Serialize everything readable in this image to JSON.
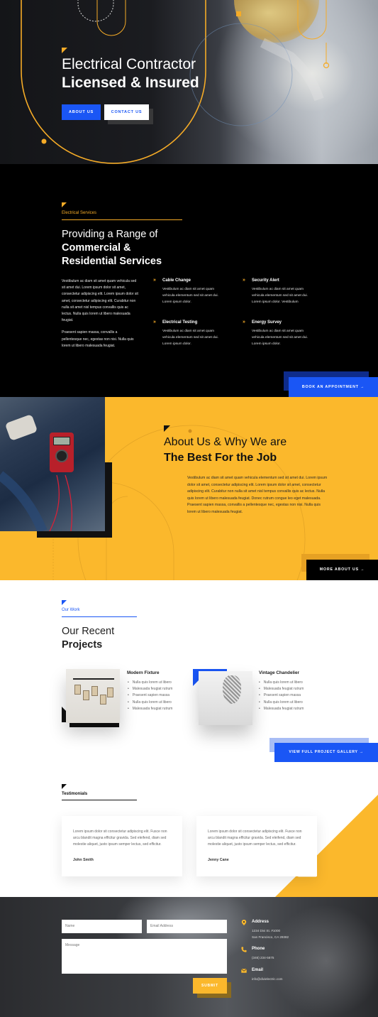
{
  "hero": {
    "title_line1": "Electrical Contractor",
    "title_line2": "Licensed & Insured",
    "about_button": "ABOUT US",
    "contact_button": "CONTACT US",
    "accent_color": "#f5ab27",
    "primary_color": "#1a56f5"
  },
  "services": {
    "kicker": "Electrical Services",
    "heading_line1": "Providing a Range of",
    "heading_line2": "Commercial &",
    "heading_line3": "Residential Services",
    "paragraph1": "Vestibulum ac diam sit amet quam vehicula sed sit amet dui. Lorem ipsum dolor sit amet, consectetur adipiscing elit. Lorem ipsum dolor sit amet, consectetur adipiscing elit. Curabitur non nulla sit amet nisl tempus convallis quis ac lectus. Nulla quis lorem ut libero malesuada feugiat.",
    "paragraph2": "Praesent sapien massa, convallis a pellentesque nec, egestas non nisi. Nulla quis lorem ut libero malesuada feugiat.",
    "items": [
      {
        "title": "Cable Change",
        "desc": "Vestibulum ac diam sit amet quam vehicula elementum sed sit amet dui. Lorem ipsum dolor."
      },
      {
        "title": "Security Alert",
        "desc": "Vestibulum ac diam sit amet quam vehicula elementum sed sit amet dui. Lorem ipsum dolor. Vestibulum"
      },
      {
        "title": "Electrical Testing",
        "desc": "Vestibulum ac diam sit amet quam vehicula elementum sed sit amet dui. Lorem ipsum dolor."
      },
      {
        "title": "Energy Survey",
        "desc": "Vestibulum ac diam sit amet quam vehicula elementum sed sit amet dui. Lorem ipsum dolor."
      }
    ],
    "book_button": "BOOK AN APPOINTMENT →"
  },
  "about": {
    "heading_line1": "About Us & Why We are",
    "heading_line2": "The Best For the Job",
    "paragraph": "Vestibulum ac diam sit amet quam vehicula elementum sed sit amet dui. Lorem ipsum dolor sit amet, consectetur adipiscing elit. Lorem ipsum dolor sit amet, consectetur adipiscing elit. Curabitur non nulla sit amet nisl tempus convallis quis ac lectus. Nulla quis lorem ut libero malesuada feugiat. Donec rutrum congue leo eget malesuada. Praesent sapien massa, convallis a pellentesque nec, egestas non nisi. Nulla quis lorem ut libero malesuada feugiat.",
    "more_button": "MORE ABOUT US →",
    "bg_color": "#fbb82c"
  },
  "projects": {
    "kicker": "Our Work",
    "heading_line1": "Our Recent",
    "heading_line2": "Projects",
    "items": [
      {
        "title": "Modern Fixture",
        "bullets": [
          "Nulla quis lorem ut libero",
          "Malesuada feugiat rutrum",
          "Praesent sapien massa",
          "Nulla quis lorem ut libero",
          "Malesuada feugiat rutrum"
        ]
      },
      {
        "title": "Vintage Chandelier",
        "bullets": [
          "Nulla quis lorem ut libero",
          "Malesuada feugiat rutrum",
          "Praesent sapien massa",
          "Nulla quis lorem ut libero",
          "Malesuada feugiat rutrum"
        ]
      }
    ],
    "gallery_button": "VIEW FULL PROJECT GALLERY →"
  },
  "testimonials": {
    "kicker": "Testimonials",
    "items": [
      {
        "quote": "Lorem ipsum dolor sit consectetur adipiscing elit. Fusce non arcu blandit magna efficitur gravida. Sed eleifend, diam sed molestie aliquet, justo ipsum semper lectus, sed efficitur.",
        "name": "John Smith"
      },
      {
        "quote": "Lorem ipsum dolor sit consectetur adipiscing elit. Fusce non arcu blandit magna efficitur gravida. Sed eleifend, diam sed molestie aliquet, justo ipsum semper lectus, sed efficitur.",
        "name": "Jenny Cane"
      }
    ]
  },
  "contact": {
    "name_placeholder": "Name",
    "email_placeholder": "Email Address",
    "message_placeholder": "Message",
    "submit_button": "SUBMIT",
    "address_label": "Address",
    "address_line1": "1234 Divi St. #1000",
    "address_line2": "San Francisco, CA 29382",
    "phone_label": "Phone",
    "phone_value": "(346) 234-5675",
    "email_label": "Email",
    "email_value": "info@divielectric.com"
  }
}
